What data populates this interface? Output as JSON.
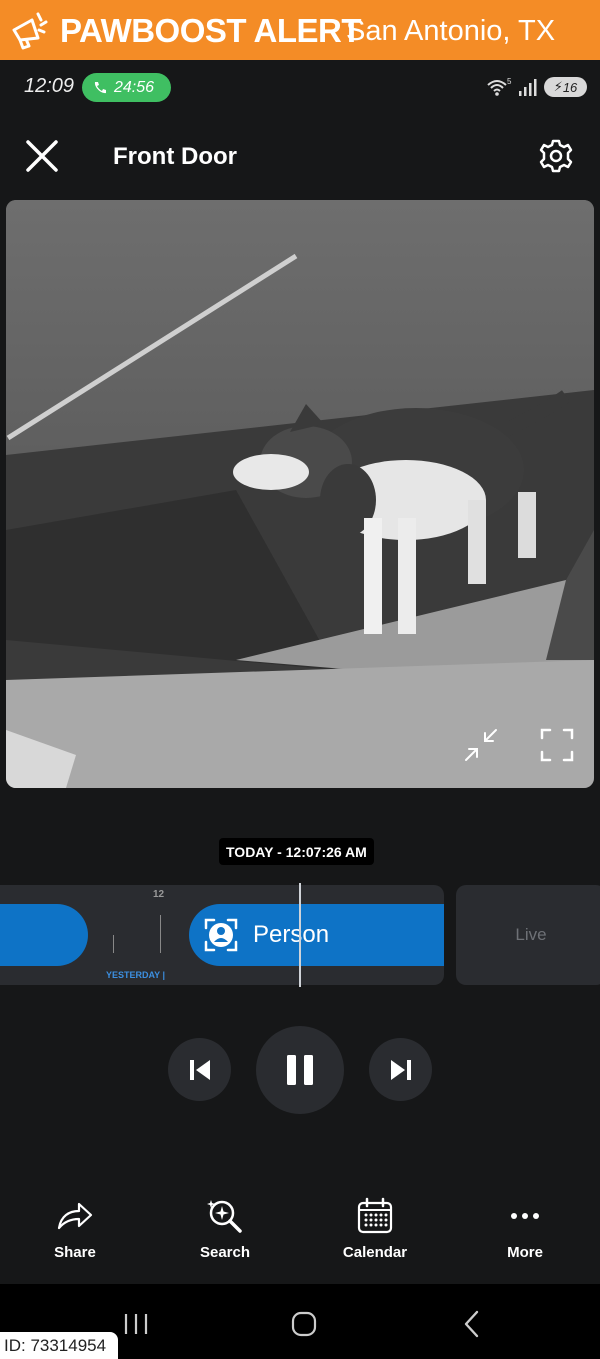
{
  "alert": {
    "title": "PAWBOOST ALERT",
    "location": "San Antonio, TX",
    "color": "#f48c26",
    "icon": "megaphone-icon"
  },
  "status_bar": {
    "time": "12:09",
    "call_timer": "24:56",
    "wifi_badge": "5",
    "battery": "16"
  },
  "header": {
    "title": "Front Door",
    "close_icon": "close-icon",
    "settings_icon": "gear-icon"
  },
  "video": {
    "minimize_icon": "minimize-icon",
    "fullscreen_icon": "fullscreen-icon"
  },
  "timeline": {
    "timestamp": "TODAY - 12:07:26 AM",
    "hour_tick": "12",
    "yesterday_label": "YESTERDAY",
    "event_label": "Person",
    "live_label": "Live",
    "accent": "#0e73c6"
  },
  "toolbar": {
    "share": "Share",
    "search": "Search",
    "calendar": "Calendar",
    "more": "More"
  },
  "footer": {
    "id": "ID: 73314954"
  }
}
